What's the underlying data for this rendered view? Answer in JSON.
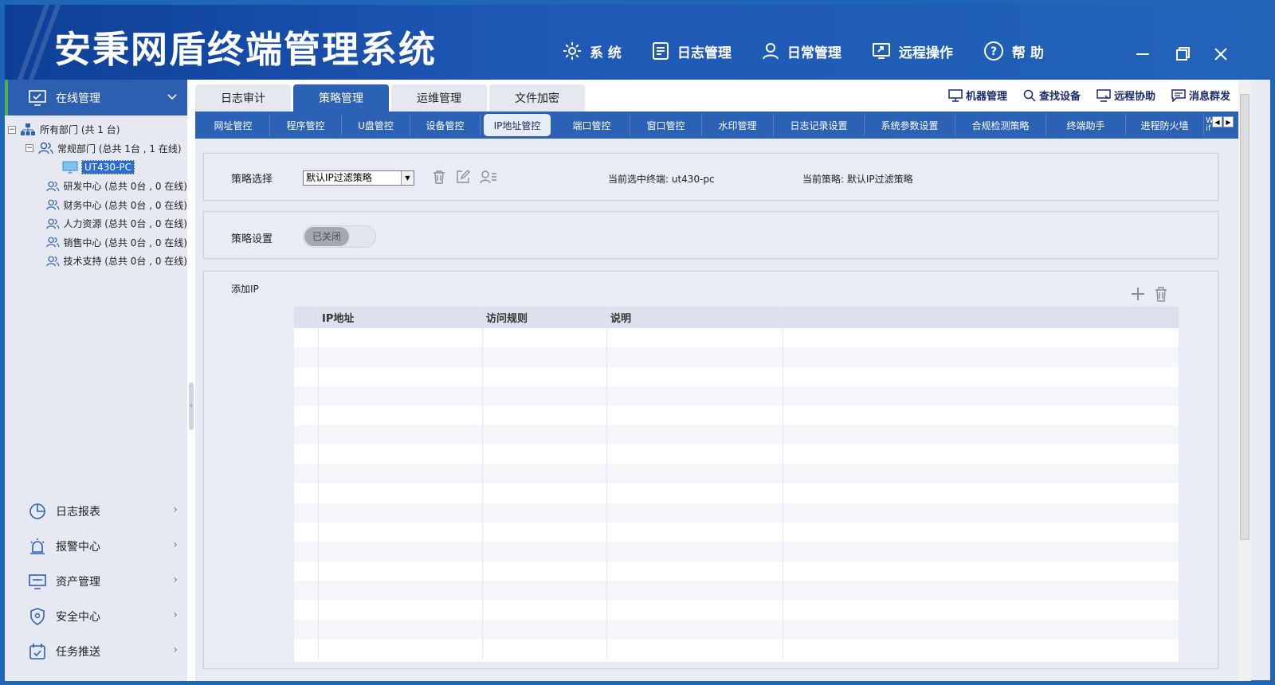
{
  "app": {
    "title": "安秉网盾终端管理系统"
  },
  "top_menu": [
    {
      "label": "系 统",
      "icon": "gear-icon"
    },
    {
      "label": "日志管理",
      "icon": "document-icon"
    },
    {
      "label": "日常管理",
      "icon": "user-icon"
    },
    {
      "label": "远程操作",
      "icon": "remote-screen-icon"
    },
    {
      "label": "帮 助",
      "icon": "help-icon"
    }
  ],
  "sidebar": {
    "header": "在线管理",
    "tree": {
      "root": "所有部门 (共 1 台)",
      "group": "常规部门 (总共 1台 , 1 在线)",
      "selected_pc": "UT430-PC",
      "departments": [
        "研发中心 (总共 0台 , 0 在线)",
        "财务中心 (总共 0台 , 0 在线)",
        "人力资源 (总共 0台 , 0 在线)",
        "销售中心 (总共 0台 , 0 在线)",
        "技术支持 (总共 0台 , 0 在线)"
      ]
    },
    "bottom_items": [
      "日志报表",
      "报警中心",
      "资产管理",
      "安全中心",
      "任务推送"
    ]
  },
  "tabs_main": [
    "日志审计",
    "策略管理",
    "运维管理",
    "文件加密"
  ],
  "tools": [
    "机器管理",
    "查找设备",
    "远程协助",
    "消息群发"
  ],
  "sub_tabs": [
    "网址管控",
    "程序管控",
    "U盘管控",
    "设备管控",
    "IP地址管控",
    "端口管控",
    "窗口管控",
    "水印管理",
    "日志记录设置",
    "系统参数设置",
    "合规检测策略",
    "终端助手",
    "进程防火墙",
    "W\nif"
  ],
  "policy": {
    "select_label": "策略选择",
    "selected": "默认IP过滤策略",
    "current_terminal_label": "当前选中终端: ut430-pc",
    "current_policy_label": "当前策略: 默认IP过滤策略"
  },
  "setting": {
    "label": "策略设置",
    "toggle": "已关闭"
  },
  "ip_table": {
    "title": "添加IP",
    "columns": [
      "",
      "IP地址",
      "访问规则",
      "说明",
      ""
    ]
  }
}
